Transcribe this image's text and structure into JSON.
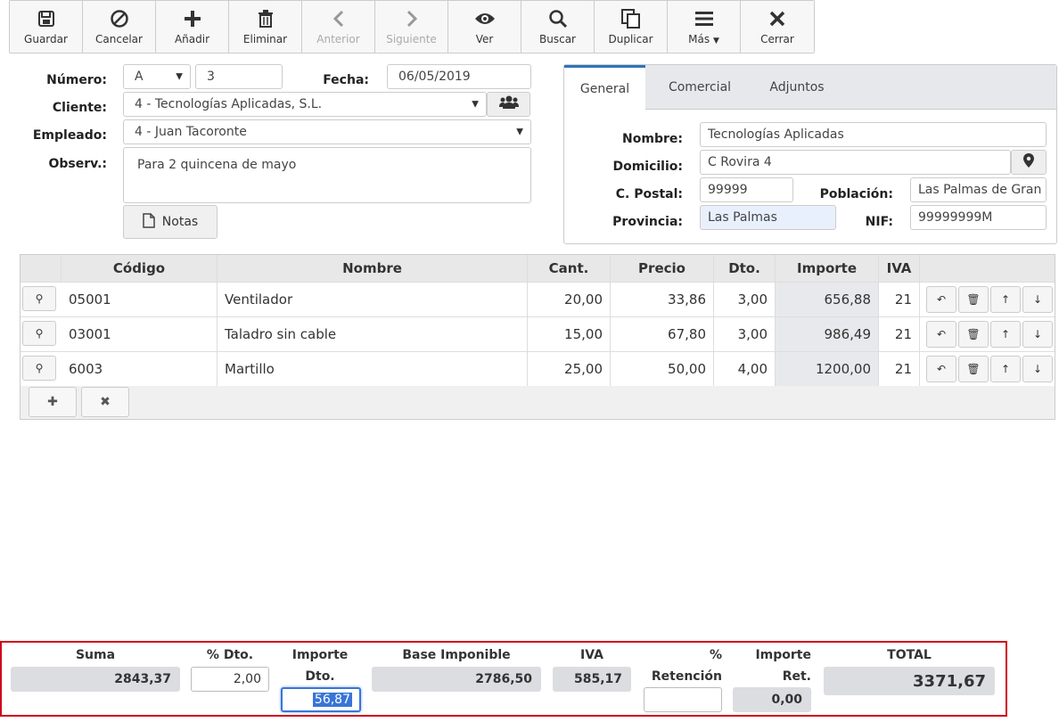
{
  "toolbar": [
    {
      "label": "Guardar",
      "icon": "save-icon",
      "enabled": true
    },
    {
      "label": "Cancelar",
      "icon": "cancel-icon",
      "enabled": true
    },
    {
      "label": "Añadir",
      "icon": "plus-icon",
      "enabled": true
    },
    {
      "label": "Eliminar",
      "icon": "trash-icon",
      "enabled": true
    },
    {
      "label": "Anterior",
      "icon": "chevron-left-icon",
      "enabled": false
    },
    {
      "label": "Siguiente",
      "icon": "chevron-right-icon",
      "enabled": false
    },
    {
      "label": "Ver",
      "icon": "eye-icon",
      "enabled": true
    },
    {
      "label": "Buscar",
      "icon": "search-icon",
      "enabled": true
    },
    {
      "label": "Duplicar",
      "icon": "duplicate-icon",
      "enabled": true
    },
    {
      "label": "Más",
      "icon": "menu-icon",
      "enabled": true
    },
    {
      "label": "Cerrar",
      "icon": "close-icon",
      "enabled": true
    }
  ],
  "form": {
    "numero_label": "Número:",
    "serie": "A",
    "numero": "3",
    "fecha_label": "Fecha:",
    "fecha": "06/05/2019",
    "cliente_label": "Cliente:",
    "cliente": "4 - Tecnologías Aplicadas, S.L.",
    "empleado_label": "Empleado:",
    "empleado": "4 - Juan Tacoronte",
    "observ_label": "Observ.:",
    "observ": "Para 2 quincena de mayo",
    "notas_label": "Notas"
  },
  "panel": {
    "tabs": [
      "General",
      "Comercial",
      "Adjuntos"
    ],
    "active_tab": "General",
    "nombre_label": "Nombre:",
    "nombre": "Tecnologías Aplicadas",
    "domicilio_label": "Domicilio:",
    "domicilio": "C Rovira 4",
    "cpostal_label": "C. Postal:",
    "cpostal": "99999",
    "poblacion_label": "Población:",
    "poblacion": "Las Palmas de Gran",
    "provincia_label": "Provincia:",
    "provincia": "Las Palmas",
    "nif_label": "NIF:",
    "nif": "99999999M"
  },
  "lines": {
    "headers": [
      "Código",
      "Nombre",
      "Cant.",
      "Precio",
      "Dto.",
      "Importe",
      "IVA"
    ],
    "rows": [
      {
        "codigo": "05001",
        "nombre": "Ventilador",
        "cant": "20,00",
        "precio": "33,86",
        "dto": "3,00",
        "importe": "656,88",
        "iva": "21"
      },
      {
        "codigo": "03001",
        "nombre": "Taladro sin cable",
        "cant": "15,00",
        "precio": "67,80",
        "dto": "3,00",
        "importe": "986,49",
        "iva": "21"
      },
      {
        "codigo": "6003",
        "nombre": "Martillo",
        "cant": "25,00",
        "precio": "50,00",
        "dto": "4,00",
        "importe": "1200,00",
        "iva": "21"
      }
    ]
  },
  "totals": {
    "suma_label": "Suma",
    "suma": "2843,37",
    "pdto_label": "% Dto.",
    "pdto": "2,00",
    "importe_dto_label1": "Importe",
    "importe_dto_label2": "Dto.",
    "importe_dto": "56,87",
    "base_label": "Base Imponible",
    "base": "2786,50",
    "iva_label": "IVA",
    "iva": "585,17",
    "pret_label1": "%",
    "pret_label2": "Retención",
    "pret": "",
    "importe_ret_label1": "Importe",
    "importe_ret_label2": "Ret.",
    "importe_ret": "0,00",
    "total_label": "TOTAL",
    "total": "3371,67"
  },
  "colors": {
    "accent": "#2e75b6",
    "highlight_border": "#d0021b",
    "selection": "#3875d7"
  }
}
